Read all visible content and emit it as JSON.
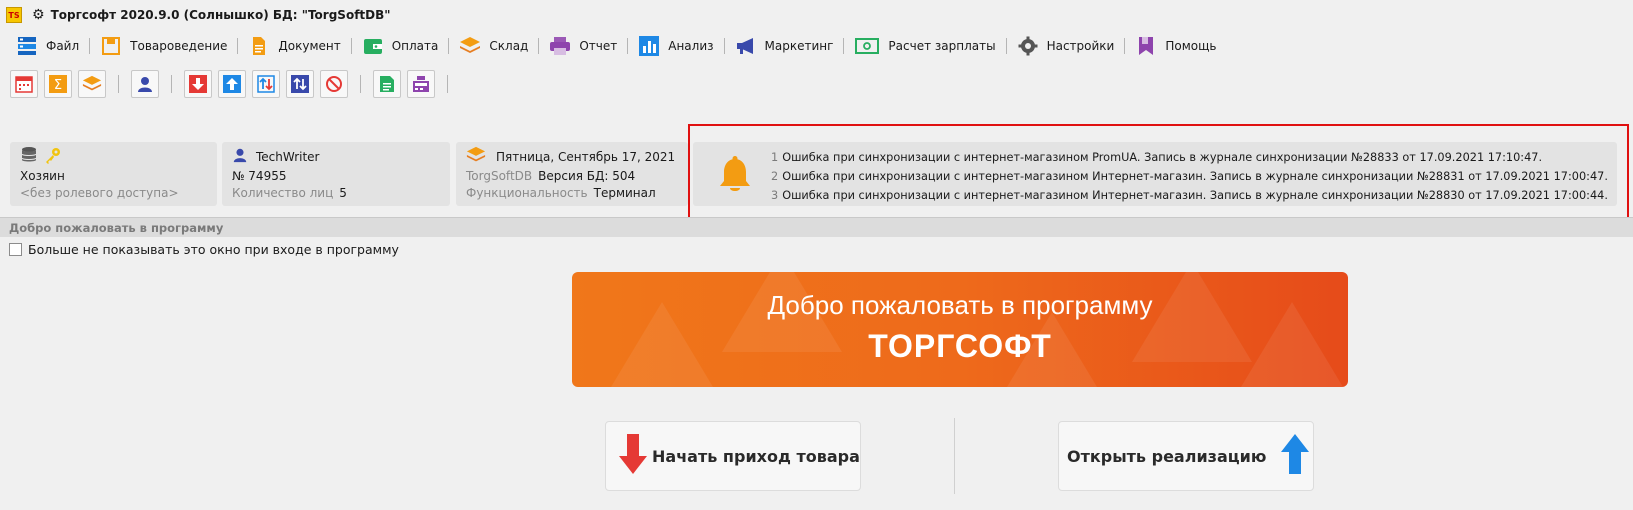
{
  "app": {
    "logo_text": "TS",
    "title": "Торгсофт 2020.9.0 (Солнышко) БД: \"TorgSoftDB\""
  },
  "menu": [
    {
      "label": "Файл",
      "icon": "file-icon"
    },
    {
      "label": "Товароведение",
      "icon": "goods-icon"
    },
    {
      "label": "Документ",
      "icon": "document-icon"
    },
    {
      "label": "Оплата",
      "icon": "wallet-icon"
    },
    {
      "label": "Склад",
      "icon": "warehouse-icon"
    },
    {
      "label": "Отчет",
      "icon": "printer-icon"
    },
    {
      "label": "Анализ",
      "icon": "chart-icon"
    },
    {
      "label": "Маркетинг",
      "icon": "megaphone-icon"
    },
    {
      "label": "Расчет зарплаты",
      "icon": "money-icon"
    },
    {
      "label": "Настройки",
      "icon": "gear-icon"
    },
    {
      "label": "Помощь",
      "icon": "bookmark-icon"
    }
  ],
  "toolbar": [
    "calendar-icon",
    "sum-icon",
    "layers-icon",
    "user-icon",
    "arrow-down-icon",
    "arrow-up-icon",
    "exchange-icon",
    "transfer-icon",
    "cancel-icon",
    "sheet-icon",
    "cash-register-icon"
  ],
  "info": {
    "role": "Хозяин",
    "role_access": "<без ролевого доступа>",
    "user_name": "TechWriter",
    "user_number": "№ 74955",
    "persons_label": "Количество лиц",
    "persons_count": "5",
    "date": "Пятница, Сентябрь 17, 2021",
    "db_name": "TorgSoftDB",
    "db_version": "Версия БД: 504",
    "func_label": "Функциональность",
    "func_value": "Терминал"
  },
  "notifications": [
    {
      "num": "1",
      "text": "Ошибка при синхронизации с интернет-магазином PromUA. Запись в журнале синхронизации №28833 от 17.09.2021 17:10:47."
    },
    {
      "num": "2",
      "text": "Ошибка при синхронизации с интернет-магазином Интернет-магазин. Запись в журнале синхронизации №28831 от 17.09.2021 17:00:47."
    },
    {
      "num": "3",
      "text": "Ошибка при синхронизации с интернет-магазином Интернет-магазин. Запись в журнале синхронизации №28830 от 17.09.2021 17:00:44."
    }
  ],
  "welcome": {
    "section_title": "Добро пожаловать в программу",
    "checkbox_label": "Больше не показывать это окно при входе в программу",
    "banner_line1": "Добро пожаловать в программу",
    "banner_line2": "ТОРГСОФТ",
    "btn_income": "Начать приход товара",
    "btn_sales": "Открыть реализацию"
  },
  "colors": {
    "banner_orange": "#ee6a1b",
    "bell_orange": "#f39c12",
    "highlight_red": "#e01010",
    "arrow_red": "#e53935",
    "arrow_blue": "#1e88e5"
  }
}
